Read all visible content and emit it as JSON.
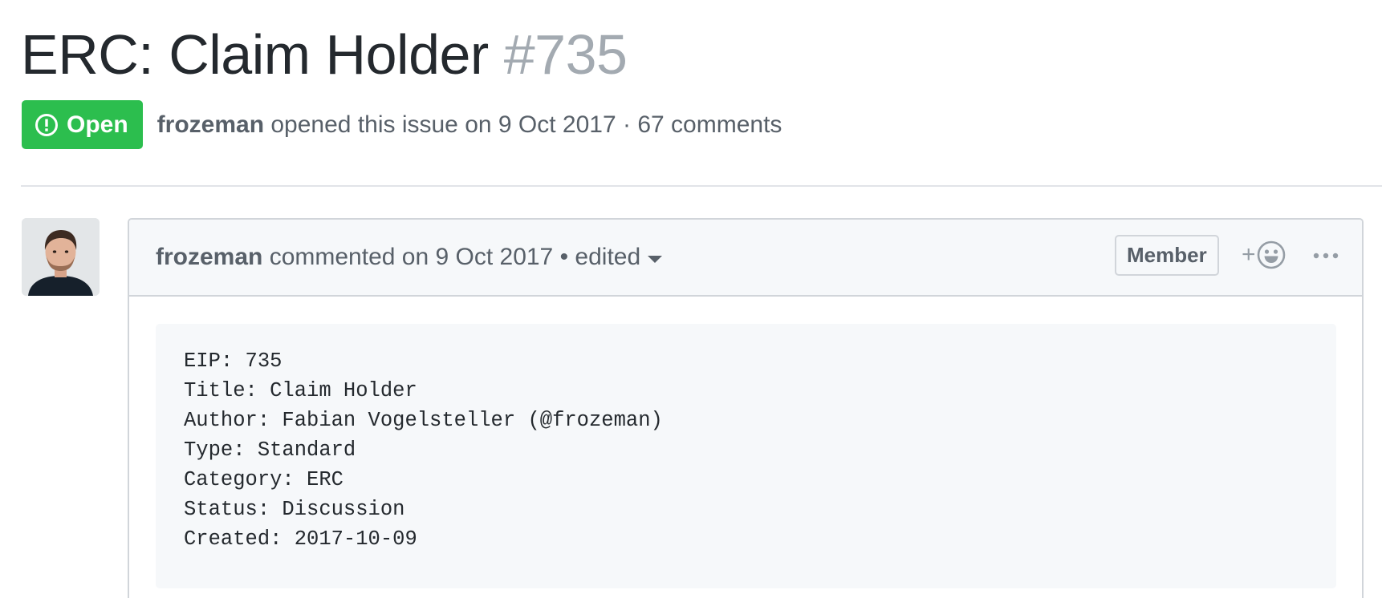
{
  "issue": {
    "title": "ERC: Claim Holder",
    "number": "#735",
    "state_label": "Open",
    "author": "frozeman",
    "opened_text": "opened this issue on 9 Oct 2017 · 67 comments",
    "state_color": "#2cbe4e"
  },
  "comment": {
    "author": "frozeman",
    "commented_text": "commented on 9 Oct 2017 • edited",
    "role_label": "Member",
    "reaction_icon": "smiley-plus-icon",
    "menu_icon": "kebab-horizontal-icon",
    "body_lines": [
      "EIP: 735",
      "Title: Claim Holder",
      "Author: Fabian Vogelsteller (@frozeman)",
      "Type: Standard",
      "Category: ERC",
      "Status: Discussion",
      "Created: 2017-10-09"
    ]
  }
}
